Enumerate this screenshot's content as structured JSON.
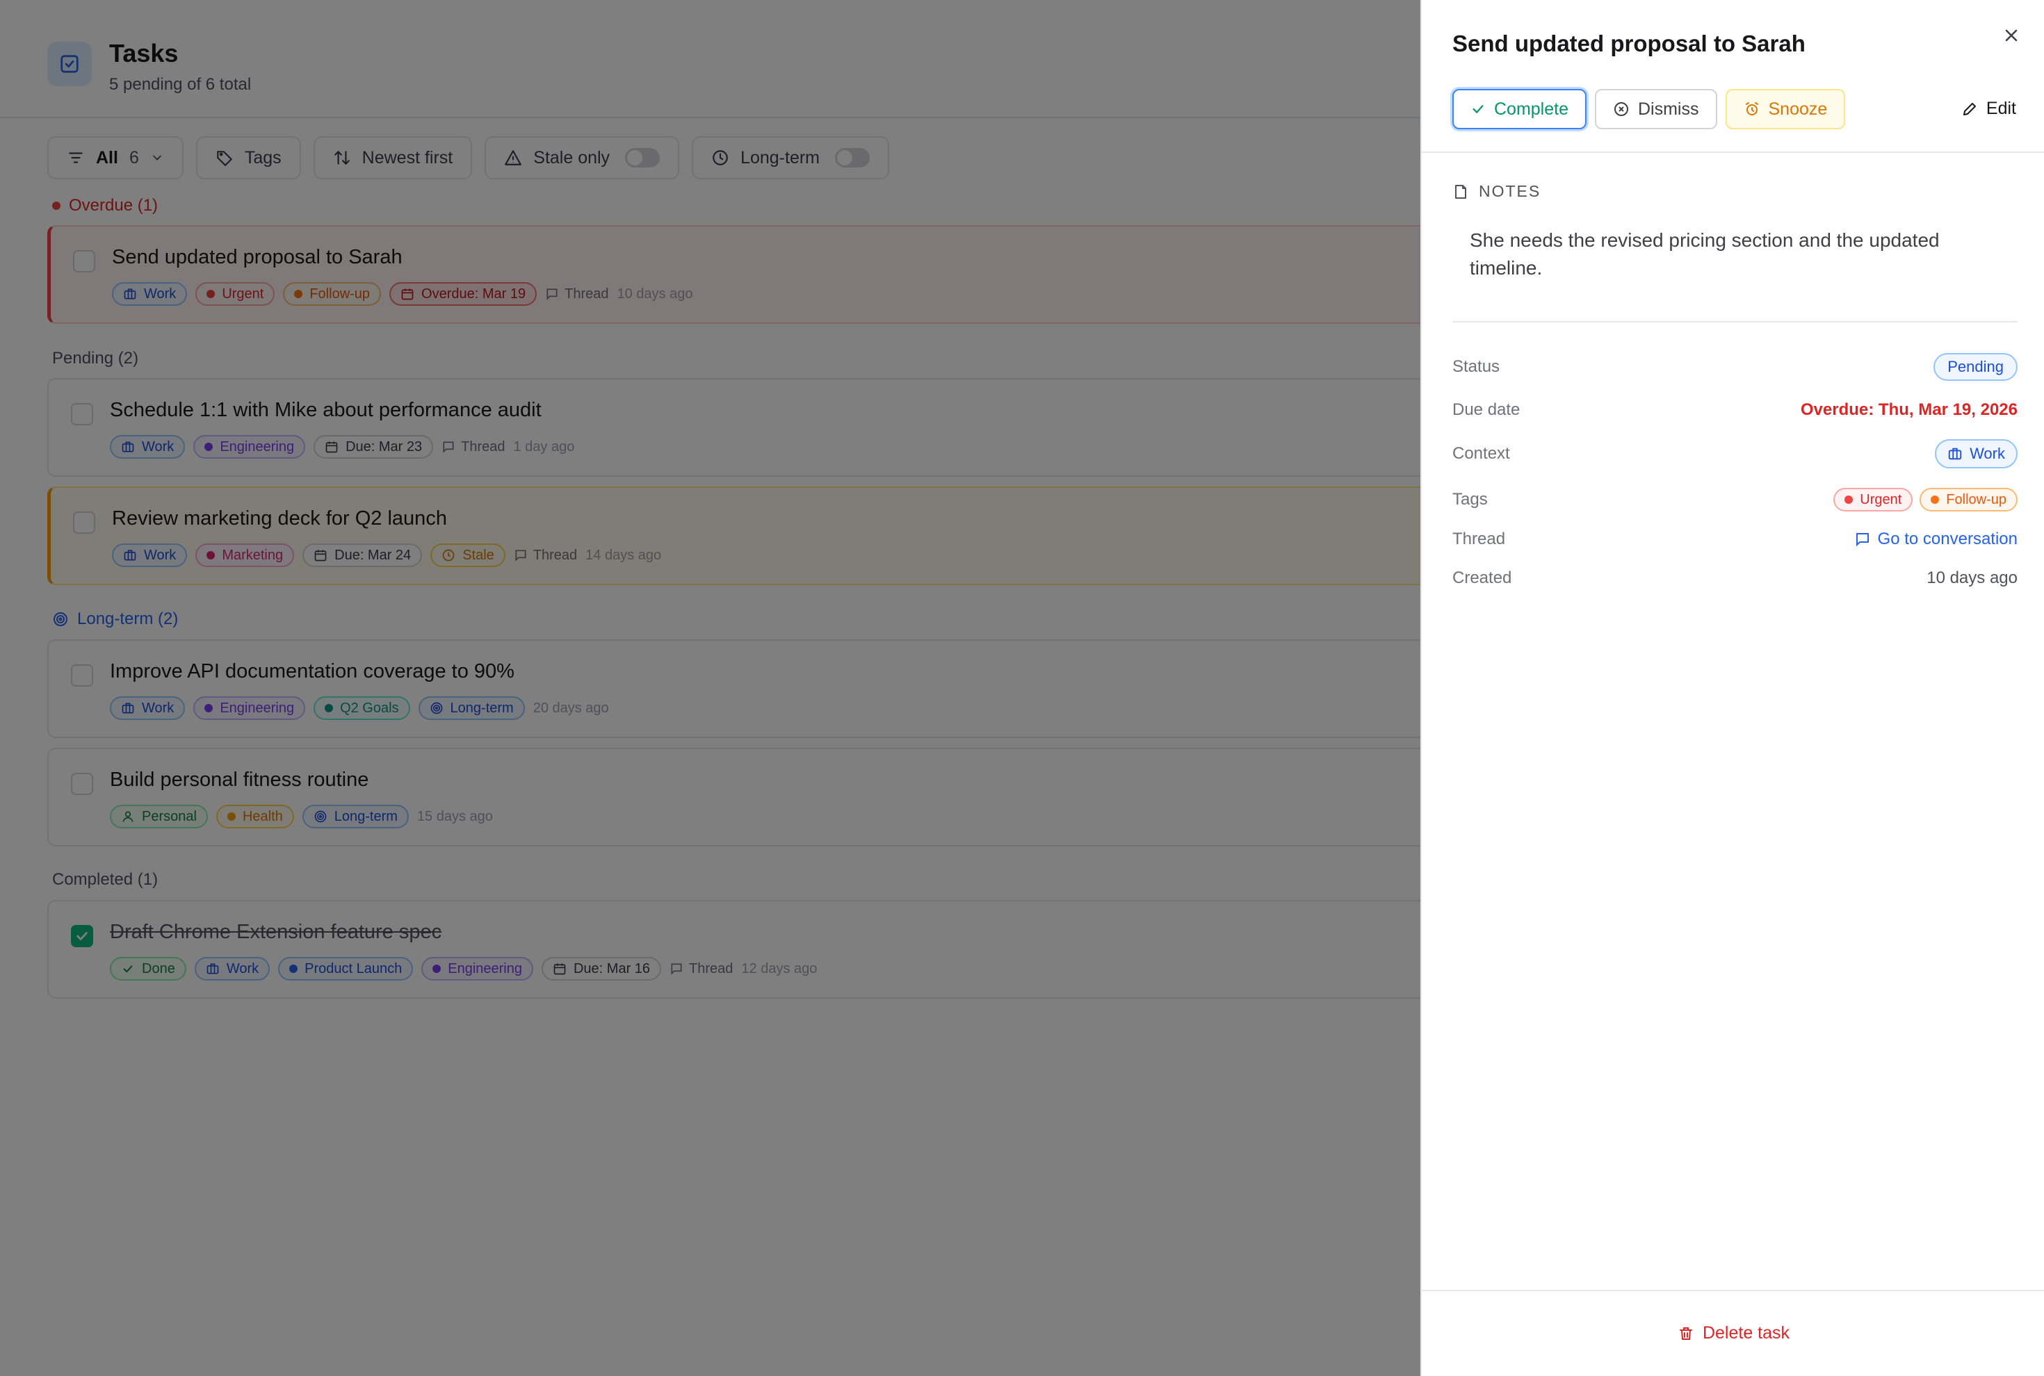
{
  "header": {
    "title": "Tasks",
    "subtitle": "5 pending of 6 total"
  },
  "toolbar": {
    "filter_label": "All",
    "filter_count": "6",
    "tags_label": "Tags",
    "sort_label": "Newest first",
    "stale_label": "Stale only",
    "longterm_label": "Long-term"
  },
  "sections": {
    "overdue": "Overdue (1)",
    "pending": "Pending (2)",
    "longterm": "Long-term (2)",
    "completed": "Completed (1)"
  },
  "tasks": [
    {
      "title": "Send updated proposal to Sarah",
      "tags": [
        "Work",
        "Urgent",
        "Follow-up"
      ],
      "due": "Overdue: Mar 19",
      "thread": "Thread",
      "ago": "10 days ago"
    },
    {
      "title": "Schedule 1:1 with Mike about performance audit",
      "tags": [
        "Work",
        "Engineering"
      ],
      "due": "Due: Mar 23",
      "thread": "Thread",
      "ago": "1 day ago"
    },
    {
      "title": "Review marketing deck for Q2 launch",
      "tags": [
        "Work",
        "Marketing"
      ],
      "due": "Due: Mar 24",
      "stale": "Stale",
      "thread": "Thread",
      "ago": "14 days ago"
    },
    {
      "title": "Improve API documentation coverage to 90%",
      "tags": [
        "Work",
        "Engineering",
        "Q2 Goals",
        "Long-term"
      ],
      "ago": "20 days ago"
    },
    {
      "title": "Build personal fitness routine",
      "tags": [
        "Personal",
        "Health",
        "Long-term"
      ],
      "ago": "15 days ago"
    },
    {
      "title": "Draft Chrome Extension feature spec",
      "tags": [
        "Done",
        "Work",
        "Product Launch",
        "Engineering"
      ],
      "due": "Due: Mar 16",
      "thread": "Thread",
      "ago": "12 days ago"
    }
  ],
  "panel": {
    "title": "Send updated proposal to Sarah",
    "complete_label": "Complete",
    "dismiss_label": "Dismiss",
    "snooze_label": "Snooze",
    "edit_label": "Edit",
    "notes_heading": "NOTES",
    "notes_text": "She needs the revised pricing section and the updated timeline.",
    "fields": {
      "status_label": "Status",
      "status_value": "Pending",
      "due_label": "Due date",
      "due_value": "Overdue: Thu, Mar 19, 2026",
      "context_label": "Context",
      "context_value": "Work",
      "tags_label": "Tags",
      "tag1": "Urgent",
      "tag2": "Follow-up",
      "thread_label": "Thread",
      "thread_link": "Go to conversation",
      "created_label": "Created",
      "created_value": "10 days ago"
    },
    "delete_label": "Delete task"
  },
  "colors": {
    "accent": "#2563eb",
    "danger": "#dc2626",
    "success": "#059669",
    "warning": "#d97706"
  }
}
